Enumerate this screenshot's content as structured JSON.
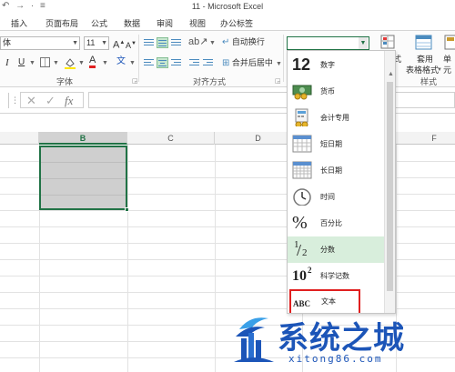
{
  "window": {
    "title": "11 - Microsoft Excel",
    "quick_access": "↶ → · ≡"
  },
  "tabs": [
    "插入",
    "页面布局",
    "公式",
    "数据",
    "审阅",
    "视图",
    "办公标签"
  ],
  "ribbon": {
    "font_name": "体",
    "font_size": "11",
    "increase_font_label": "A",
    "decrease_font_label": "A",
    "italic_label": "I",
    "underline_label": "U",
    "font_color_label": "A",
    "phonetic_label": "文",
    "wrap_text_label": "自动换行",
    "merge_center_label": "合并后居中",
    "font_group_label": "字体",
    "alignment_group_label": "对齐方式",
    "table_format_label_1": "套用",
    "table_format_label_2": "表格格式",
    "cond_format_label": "式",
    "cell_label": "单元",
    "styles_group_label": "样式"
  },
  "formula_bar": {
    "cancel_symbol": "✕",
    "enter_symbol": "✓",
    "fx_symbol": "fx"
  },
  "columns": [
    {
      "label": "B",
      "selected": true
    },
    {
      "label": "C",
      "selected": false
    },
    {
      "label": "D",
      "selected": false
    },
    {
      "label": "F",
      "selected": false
    }
  ],
  "number_format_menu": {
    "items": [
      {
        "label": "数字",
        "icon": "number-12-icon",
        "highlighted": false,
        "boxed": false
      },
      {
        "label": "货币",
        "icon": "currency-icon",
        "highlighted": false,
        "boxed": false
      },
      {
        "label": "会计专用",
        "icon": "accounting-icon",
        "highlighted": false,
        "boxed": false
      },
      {
        "label": "短日期",
        "icon": "calendar-short-icon",
        "highlighted": false,
        "boxed": false
      },
      {
        "label": "长日期",
        "icon": "calendar-long-icon",
        "highlighted": false,
        "boxed": false
      },
      {
        "label": "时间",
        "icon": "clock-icon",
        "highlighted": false,
        "boxed": false
      },
      {
        "label": "百分比",
        "icon": "percent-icon",
        "highlighted": false,
        "boxed": false
      },
      {
        "label": "分数",
        "icon": "fraction-icon",
        "highlighted": true,
        "boxed": false
      },
      {
        "label": "科学记数",
        "icon": "scientific-icon",
        "highlighted": false,
        "boxed": false
      },
      {
        "label": "文本",
        "icon": "text-abc-icon",
        "highlighted": false,
        "boxed": true
      }
    ],
    "icon_glyphs": {
      "number": "12",
      "percent": "%",
      "fraction_num": "1",
      "fraction_den": "2",
      "scientific_base": "10",
      "scientific_exp": "2",
      "text": "ABC"
    }
  },
  "watermark": {
    "title": "系统之城",
    "url": "xitong86.com"
  },
  "colors": {
    "excel_green": "#217346",
    "selection_fill": "#cfcfcf",
    "menu_highlight": "#d8eedc",
    "box_red": "#e02020",
    "watermark_blue": "#1c55b8"
  }
}
